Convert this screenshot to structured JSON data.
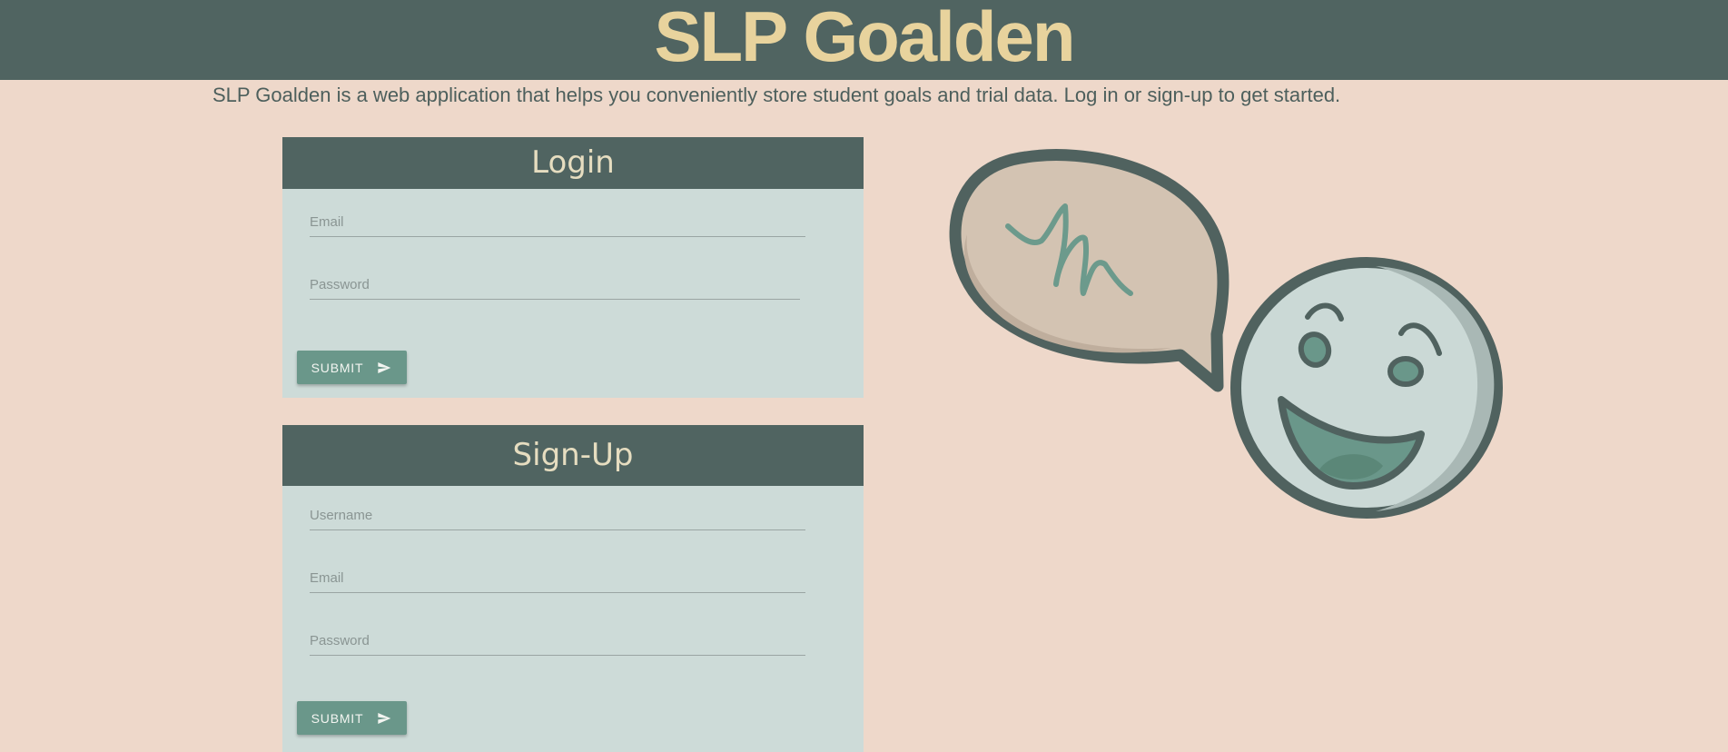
{
  "header": {
    "title": "SLP Goalden"
  },
  "intro": {
    "text": "SLP Goalden is a web application that helps you conveniently store student goals and trial data. Log in or sign-up to get started."
  },
  "login": {
    "title": "Login",
    "email_placeholder": "Email",
    "password_placeholder": "Password",
    "submit_label": "SUBMIT",
    "submit_icon": "send-icon"
  },
  "signup": {
    "title": "Sign-Up",
    "username_placeholder": "Username",
    "email_placeholder": "Email",
    "password_placeholder": "Password",
    "submit_label": "SUBMIT",
    "submit_icon": "send-icon"
  },
  "colors": {
    "page_background": "#eed8ca",
    "header_background": "#506461",
    "title_color": "#e8d39d",
    "card_background": "#cddbd8",
    "button_color": "#6a978a"
  },
  "illustration": {
    "icons": [
      "speech-bubble-icon",
      "smiley-face-icon"
    ]
  }
}
